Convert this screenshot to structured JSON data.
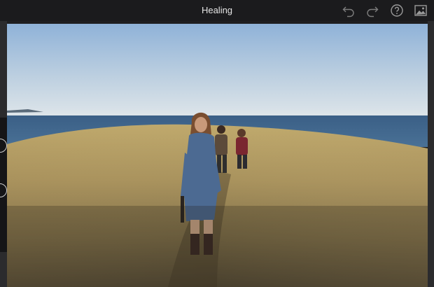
{
  "app": {
    "title": "Healing"
  },
  "toolbar": {
    "undo_icon": "undo-icon",
    "redo_icon": "redo-icon",
    "help_icon": "help-icon",
    "compare_icon": "photo-compare-icon"
  },
  "theme": {
    "bar_color": "#1b1b1d",
    "icon_color": "#8a8a8a",
    "title_color": "#e6e6e6"
  },
  "photo": {
    "subject": "photo-being-edited"
  }
}
